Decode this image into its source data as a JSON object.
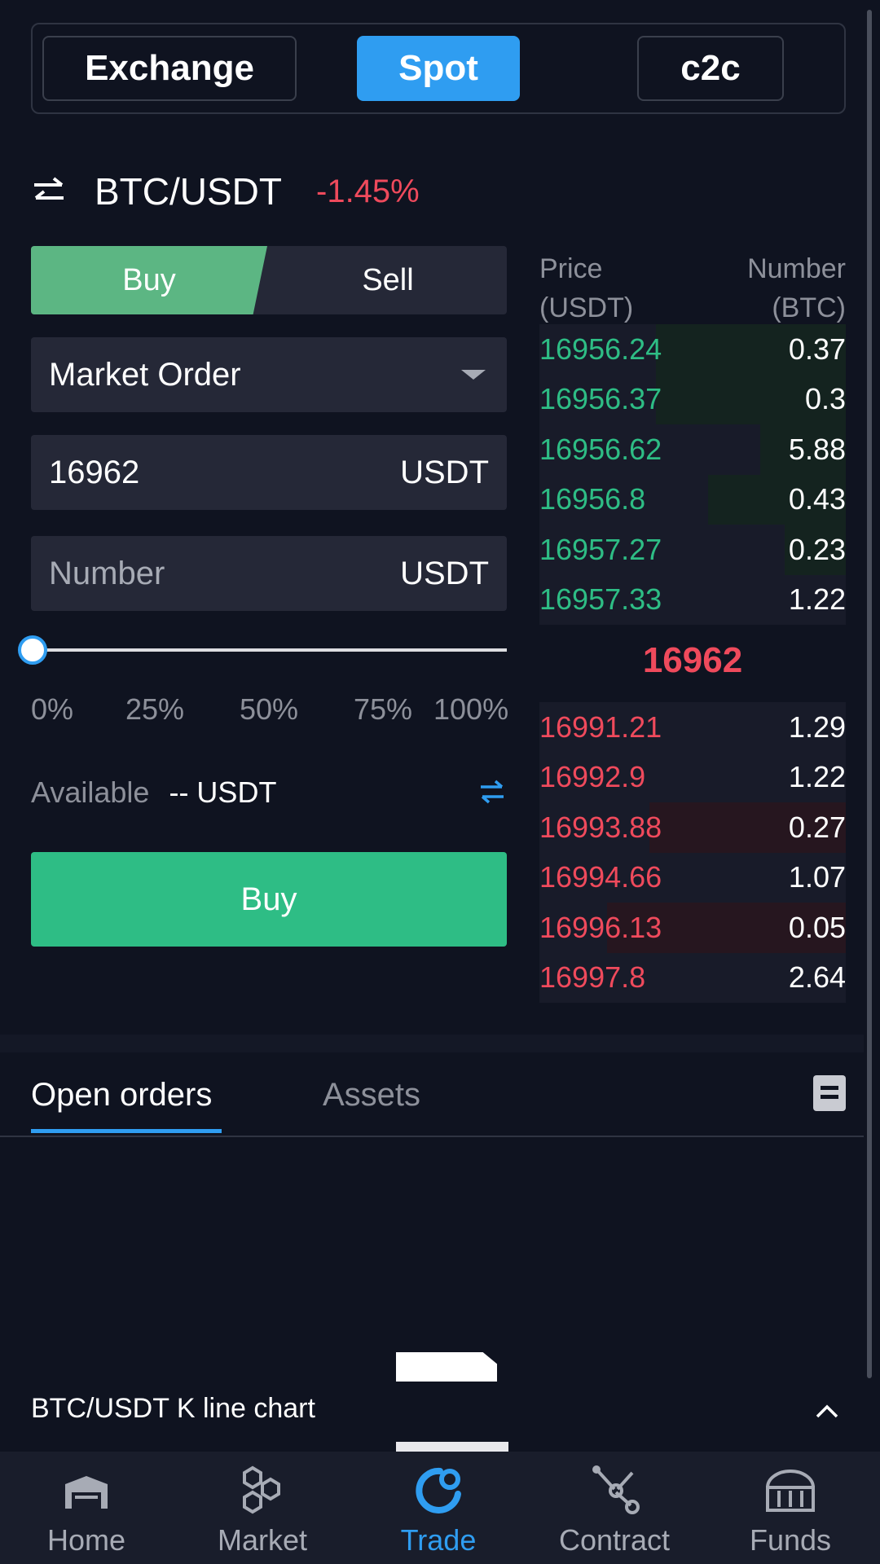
{
  "top_tabs": {
    "exchange": "Exchange",
    "spot": "Spot",
    "c2c": "c2c"
  },
  "pair": {
    "name": "BTC/USDT",
    "change": "-1.45%"
  },
  "side": {
    "buy": "Buy",
    "sell": "Sell"
  },
  "form": {
    "order_type": "Market Order",
    "price_value": "16962",
    "price_unit": "USDT",
    "amount_placeholder": "Number",
    "amount_unit": "USDT",
    "slider_fraction": 0,
    "slider_labels": [
      "0%",
      "25%",
      "50%",
      "75%",
      "100%"
    ],
    "available_label": "Available",
    "available_value": "-- USDT",
    "submit_label": "Buy"
  },
  "orderbook": {
    "price_header": [
      "Price",
      "(USDT)"
    ],
    "number_header": [
      "Number",
      "(BTC)"
    ],
    "bids": [
      {
        "price": "16956.24",
        "number": "0.37",
        "depth": 0.62
      },
      {
        "price": "16956.37",
        "number": "0.3",
        "depth": 0.62
      },
      {
        "price": "16956.62",
        "number": "5.88",
        "depth": 0.28
      },
      {
        "price": "16956.8",
        "number": "0.43",
        "depth": 0.45
      },
      {
        "price": "16957.27",
        "number": "0.23",
        "depth": 0.2
      },
      {
        "price": "16957.33",
        "number": "1.22",
        "depth": 0
      }
    ],
    "last_price": "16962",
    "asks": [
      {
        "price": "16991.21",
        "number": "1.29",
        "depth": 0
      },
      {
        "price": "16992.9",
        "number": "1.22",
        "depth": 0
      },
      {
        "price": "16993.88",
        "number": "0.27",
        "depth": 0.64
      },
      {
        "price": "16994.66",
        "number": "1.07",
        "depth": 0
      },
      {
        "price": "16996.13",
        "number": "0.05",
        "depth": 0.78
      },
      {
        "price": "16997.8",
        "number": "2.64",
        "depth": 0
      }
    ]
  },
  "bottom_tabs": {
    "open_orders": "Open orders",
    "assets": "Assets"
  },
  "kline": {
    "label": "BTC/USDT K line chart"
  },
  "nav": [
    {
      "label": "Home",
      "icon": "home-icon"
    },
    {
      "label": "Market",
      "icon": "market-icon"
    },
    {
      "label": "Trade",
      "icon": "trade-icon"
    },
    {
      "label": "Contract",
      "icon": "contract-icon"
    },
    {
      "label": "Funds",
      "icon": "funds-icon"
    }
  ],
  "colors": {
    "accent": "#2f9df1",
    "buy": "#2ebd85",
    "sell": "#ef4a5c",
    "background": "#0f1320"
  }
}
